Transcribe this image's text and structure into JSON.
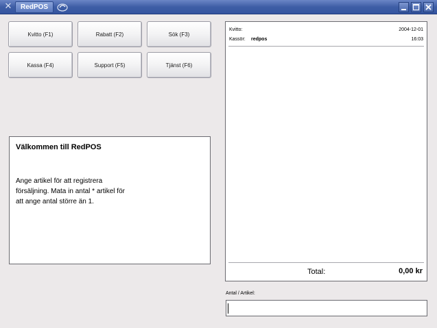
{
  "window": {
    "title": "RedPOS",
    "system_icon": "x-logo-icon",
    "controls": [
      "minimize-icon",
      "maximize-icon",
      "close-icon"
    ]
  },
  "function_buttons": [
    {
      "label": "Kvitto (F1)"
    },
    {
      "label": "Rabatt (F2)"
    },
    {
      "label": "Sök (F3)"
    },
    {
      "label": "Kassa (F4)"
    },
    {
      "label": "Support (F5)"
    },
    {
      "label": "Tjänst (F6)"
    }
  ],
  "welcome": {
    "title": "Välkommen till RedPOS",
    "lines": [
      "Ange artikel för att registrera",
      "försäljning. Mata in antal * artikel för",
      "att ange antal större än 1."
    ]
  },
  "receipt": {
    "receipt_label": "Kvitto:",
    "date": "2004-12-01",
    "cashier_label": "Kassör:",
    "cashier_name": "redpos",
    "time": "16:03",
    "total_label": "Total:",
    "total_value": "0,00 kr"
  },
  "entry": {
    "label": "Antal / Artikel:",
    "value": ""
  },
  "colors": {
    "titlebar": "#3f5ea6",
    "background": "#ece9ea",
    "panel": "#ffffff"
  }
}
